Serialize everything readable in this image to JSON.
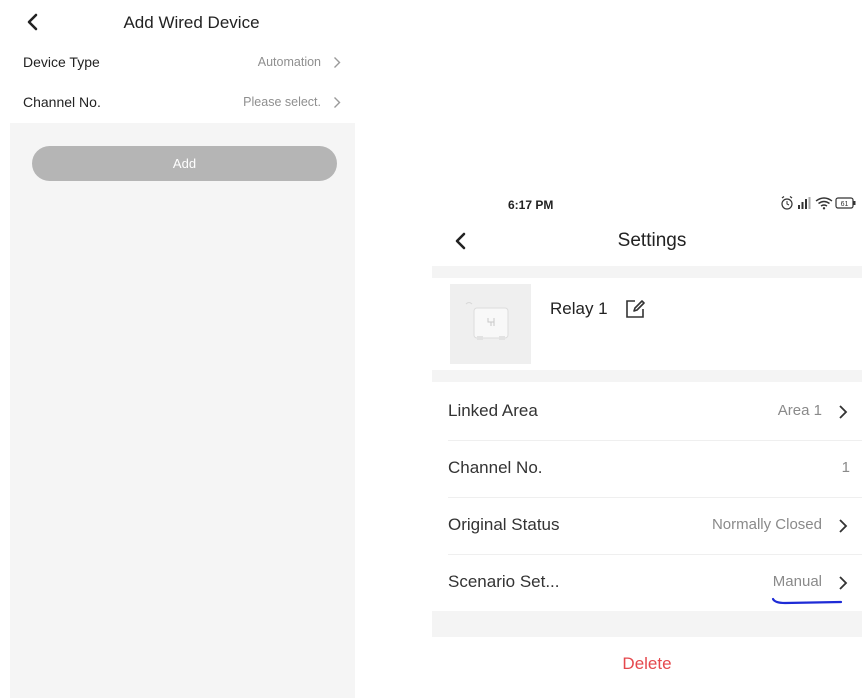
{
  "left": {
    "title": "Add Wired Device",
    "rows": [
      {
        "label": "Device Type",
        "value": "Automation"
      },
      {
        "label": "Channel No.",
        "value": "Please select."
      }
    ],
    "add_button": "Add",
    "icons": {
      "back": "chevron-left-icon",
      "row_arrow": "chevron-right-icon"
    }
  },
  "right": {
    "status_bar": {
      "time": "6:17 PM",
      "battery": "61"
    },
    "title": "Settings",
    "device": {
      "name": "Relay 1"
    },
    "rows": [
      {
        "label": "Linked Area",
        "value": "Area 1"
      },
      {
        "label": "Channel No.",
        "value": "1"
      },
      {
        "label": "Original Status",
        "value": "Normally Closed"
      },
      {
        "label": "Scenario Set...",
        "value": "Manual"
      }
    ],
    "delete_button": "Delete",
    "icons": {
      "back": "chevron-left-icon",
      "edit": "edit-icon",
      "row_arrow": "chevron-right-icon",
      "status": [
        "alarm-icon",
        "signal-icon",
        "wifi-icon",
        "battery-icon"
      ]
    },
    "colors": {
      "delete": "#e5484d",
      "annotation": "#1e2bd6"
    }
  }
}
